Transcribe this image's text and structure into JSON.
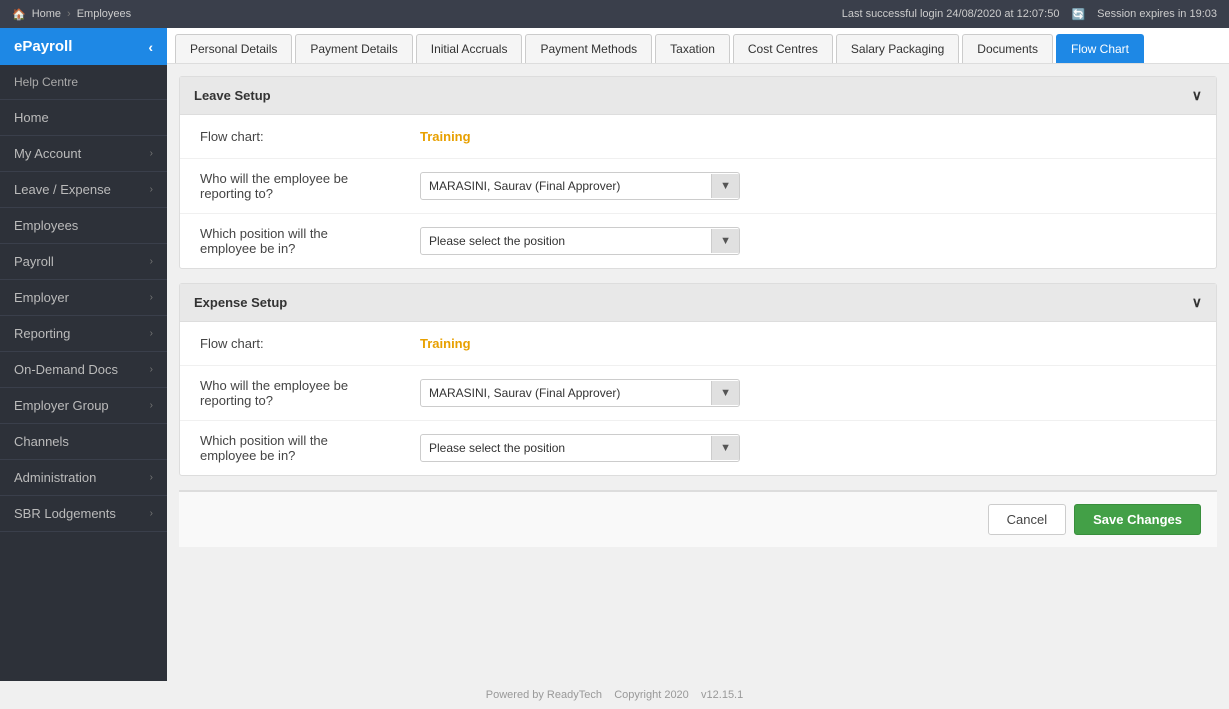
{
  "topbar": {
    "home_label": "Home",
    "breadcrumb_separator": "›",
    "breadcrumb_page": "Employees",
    "last_login": "Last successful login 24/08/2020 at 12:07:50",
    "session_expires": "Session expires in 19:03"
  },
  "sidebar": {
    "brand": "ePayroll",
    "help_centre": "Help Centre",
    "items": [
      {
        "label": "Home",
        "active": false,
        "has_chevron": false
      },
      {
        "label": "My Account",
        "active": false,
        "has_chevron": true
      },
      {
        "label": "Leave / Expense",
        "active": false,
        "has_chevron": true
      },
      {
        "label": "Employees",
        "active": false,
        "has_chevron": false
      },
      {
        "label": "Payroll",
        "active": false,
        "has_chevron": true
      },
      {
        "label": "Employer",
        "active": false,
        "has_chevron": true
      },
      {
        "label": "Reporting",
        "active": false,
        "has_chevron": true
      },
      {
        "label": "On-Demand Docs",
        "active": false,
        "has_chevron": true
      },
      {
        "label": "Employer Group",
        "active": false,
        "has_chevron": true
      },
      {
        "label": "Channels",
        "active": false,
        "has_chevron": false
      },
      {
        "label": "Administration",
        "active": false,
        "has_chevron": true
      },
      {
        "label": "SBR Lodgements",
        "active": false,
        "has_chevron": true
      }
    ]
  },
  "tabs": [
    {
      "label": "Personal Details",
      "active": false
    },
    {
      "label": "Payment Details",
      "active": false
    },
    {
      "label": "Initial Accruals",
      "active": false
    },
    {
      "label": "Payment Methods",
      "active": false
    },
    {
      "label": "Taxation",
      "active": false
    },
    {
      "label": "Cost Centres",
      "active": false
    },
    {
      "label": "Salary Packaging",
      "active": false
    },
    {
      "label": "Documents",
      "active": false
    },
    {
      "label": "Flow Chart",
      "active": true
    }
  ],
  "sections": {
    "leave_setup": {
      "title": "Leave Setup",
      "flow_chart_label": "Flow chart:",
      "flow_chart_value": "Training",
      "reporting_label": "Who will the employee be\nreporting to?",
      "reporting_value": "MARASINI, Saurav (Final Approver)",
      "position_label": "Which position will the\nemployee be in?",
      "position_placeholder": "Please select the position"
    },
    "expense_setup": {
      "title": "Expense Setup",
      "flow_chart_label": "Flow chart:",
      "flow_chart_value": "Training",
      "reporting_label": "Who will the employee be\nreporting to?",
      "reporting_value": "MARASINI, Saurav (Final Approver)",
      "position_label": "Which position will the\nemployee be in?",
      "position_placeholder": "Please select the position"
    }
  },
  "buttons": {
    "cancel": "Cancel",
    "save_changes": "Save Changes"
  },
  "footer": {
    "powered_by": "Powered by ReadyTech",
    "copyright": "Copyright 2020",
    "version": "v12.15.1"
  }
}
